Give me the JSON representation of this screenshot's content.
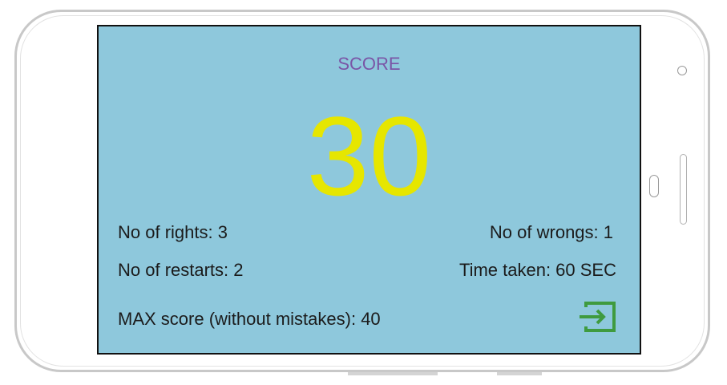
{
  "score_screen": {
    "title": "SCORE",
    "score": "30",
    "rights_text": "No of rights: 3",
    "wrongs_text": "No of wrongs: 1",
    "restarts_text": "No of restarts: 2",
    "time_text": "Time taken: 60 SEC",
    "max_score_text": "MAX score (without mistakes): 40",
    "exit_icon": "exit-to-app-icon"
  },
  "colors": {
    "screen_bg": "#8ec8dc",
    "title": "#7a55a6",
    "score": "#e6e600",
    "text": "#1b1b1b",
    "exit_icon": "#3f9b3f"
  }
}
